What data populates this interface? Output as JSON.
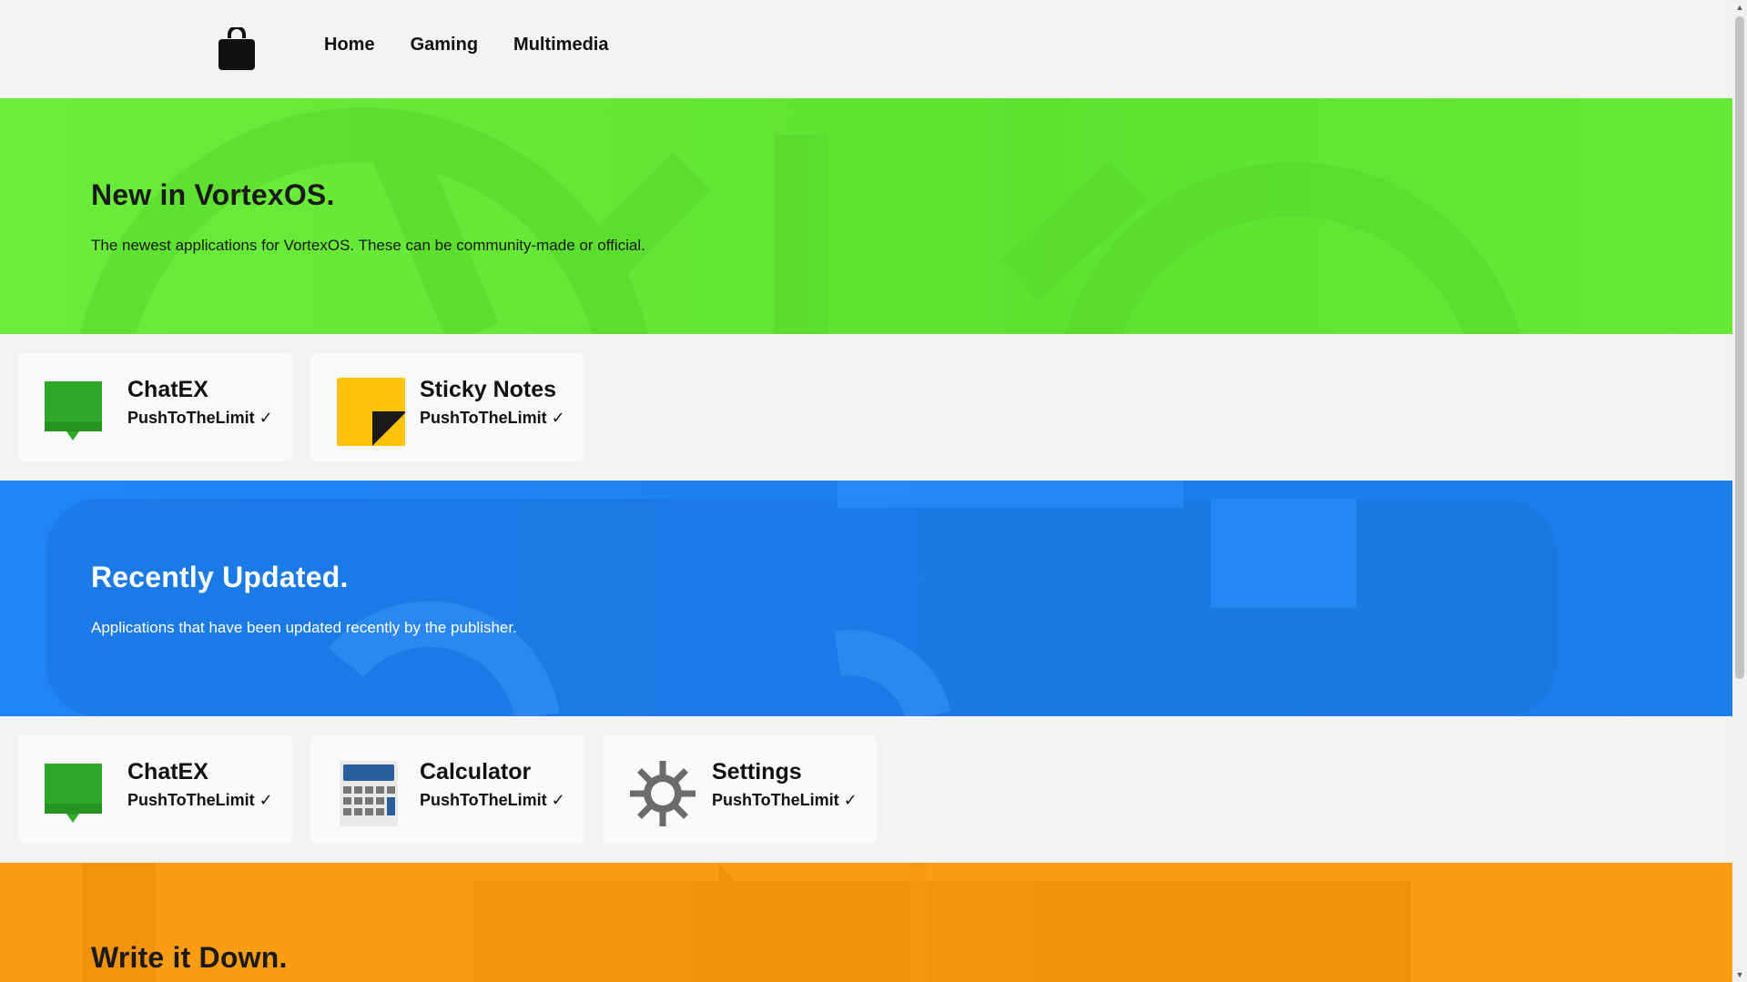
{
  "nav": {
    "links": [
      "Home",
      "Gaming",
      "Multimedia"
    ]
  },
  "sections": [
    {
      "title": "New in VortexOS.",
      "description": "The newest applications for VortexOS. These can be community-made or official.",
      "color": "#64e935",
      "apps": [
        {
          "name": "ChatEX",
          "author": "PushToTheLimit ✓",
          "icon": "chat-icon"
        },
        {
          "name": "Sticky Notes",
          "author": "PushToTheLimit ✓",
          "icon": "sticky-note-icon"
        }
      ]
    },
    {
      "title": "Recently Updated.",
      "description": "Applications that have been updated recently by the publisher.",
      "color": "#1e80ef",
      "apps": [
        {
          "name": "ChatEX",
          "author": "PushToTheLimit ✓",
          "icon": "chat-icon"
        },
        {
          "name": "Calculator",
          "author": "PushToTheLimit ✓",
          "icon": "calculator-icon"
        },
        {
          "name": "Settings",
          "author": "PushToTheLimit ✓",
          "icon": "gear-icon"
        }
      ]
    },
    {
      "title": "Write it Down.",
      "color": "#fb9d12"
    }
  ],
  "icons": {
    "logo": "shopping-bag-icon"
  }
}
